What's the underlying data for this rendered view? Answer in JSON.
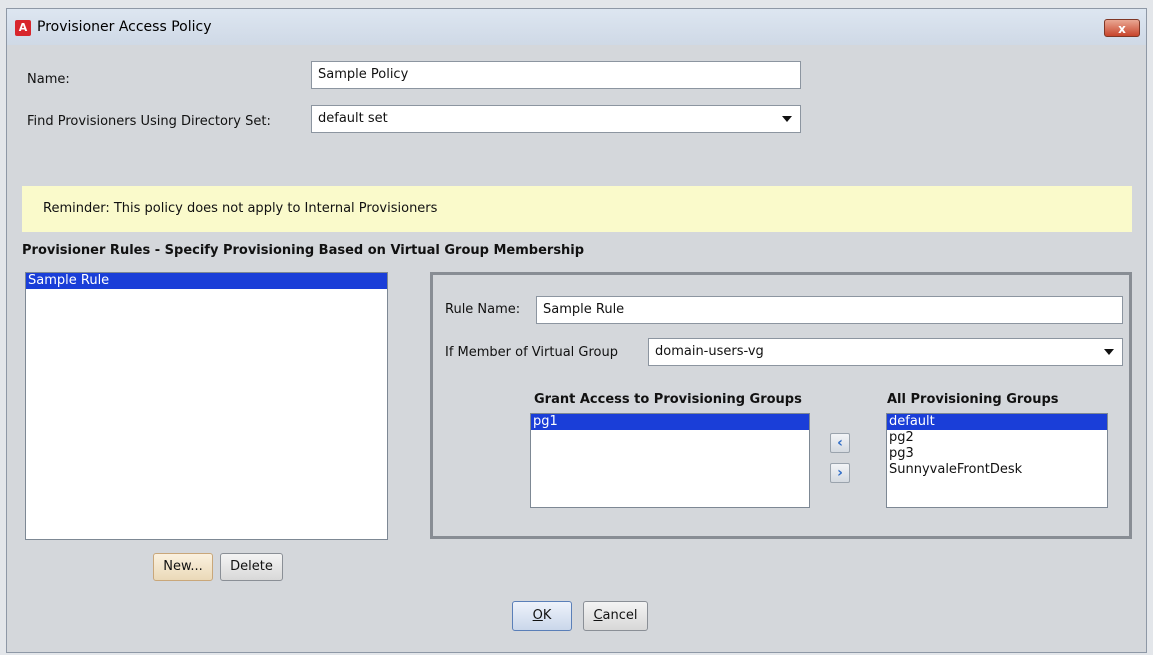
{
  "window": {
    "title": "Provisioner Access Policy",
    "app_icon_glyph": "A",
    "close_glyph": "x"
  },
  "form": {
    "name_label": "Name:",
    "name_value": "Sample Policy",
    "directory_label": "Find Provisioners Using Directory Set:",
    "directory_value": "default set"
  },
  "reminder": "Reminder:  This policy does not apply to Internal Provisioners",
  "rules_section": {
    "title": "Provisioner Rules - Specify Provisioning Based on Virtual Group Membership",
    "rules": [
      "Sample Rule"
    ],
    "new_button": "New...",
    "delete_button": "Delete"
  },
  "rule_detail": {
    "rule_name_label": "Rule Name:",
    "rule_name_value": "Sample Rule",
    "member_label": "If Member of Virtual Group",
    "member_value": "domain-users-vg",
    "grant_title": "Grant Access to Provisioning Groups",
    "grant_items": [
      "pg1"
    ],
    "all_title": "All Provisioning Groups",
    "all_items": [
      "default",
      "pg2",
      "pg3",
      "SunnyvaleFrontDesk"
    ],
    "add_glyph": "‹",
    "remove_glyph": "›"
  },
  "footer": {
    "ok_mnemonic": "O",
    "ok_rest": "K",
    "cancel_mnemonic": "C",
    "cancel_rest": "ancel"
  },
  "colors": {
    "selection": "#1a3ed8",
    "reminder_bg": "#fafacb",
    "close_button": "#c8452b"
  }
}
